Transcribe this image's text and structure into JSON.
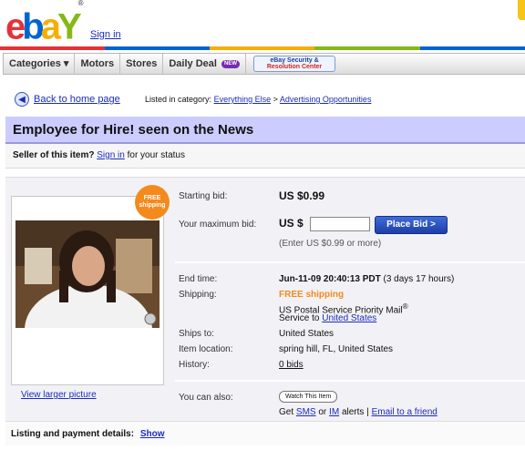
{
  "header": {
    "logo": {
      "e": "e",
      "b": "b",
      "a": "a",
      "y": "Y",
      "reg": "®"
    },
    "signin": "Sign in",
    "rainbow_colors": [
      "#e53238",
      "#0064d2",
      "#f5af02",
      "#86b817",
      "#0064d2"
    ]
  },
  "nav": {
    "categories": "Categories ▾",
    "motors": "Motors",
    "stores": "Stores",
    "daily_deal": "Daily Deal",
    "new_badge": "NEW",
    "security_l1": "eBay Security &",
    "security_l2": "Resolution Center"
  },
  "breadcrumb": {
    "back": "Back to home page",
    "listed_in": "Listed in category:",
    "cat1": "Everything Else",
    "gt": ">",
    "cat2": "Advertising Opportunities"
  },
  "item": {
    "title": "Employee for Hire! seen on the News",
    "seller_label": "Seller of this item?",
    "seller_signin": "Sign in",
    "seller_suffix": "for your status",
    "free_badge_l1": "FREE",
    "free_badge_l2": "shipping",
    "view_larger": "View larger picture"
  },
  "bid": {
    "starting_label": "Starting bid:",
    "starting_value": "US $0.99",
    "max_label": "Your maximum bid:",
    "usd": "US $",
    "input_value": "",
    "place_bid": "Place Bid >",
    "hint": "(Enter US $0.99 or more)"
  },
  "details": {
    "end_label": "End time:",
    "end_value": "Jun-11-09 20:40:13 PDT",
    "end_remaining": "(3 days 17 hours)",
    "ship_label": "Shipping:",
    "ship_free": "FREE shipping",
    "ship_service": "US Postal Service Priority Mail",
    "ship_reg": "®",
    "ship_to_prefix": "Service to",
    "ship_to_link": "United States",
    "ships_to_label": "Ships to:",
    "ships_to_value": "United States",
    "location_label": "Item location:",
    "location_value": "spring hill, FL, United States",
    "history_label": "History:",
    "history_value": "0 bids"
  },
  "also": {
    "label": "You can also:",
    "watch": "Watch This Item",
    "get": "Get",
    "sms": "SMS",
    "or": "or",
    "im": "IM",
    "alerts": "alerts |",
    "email": "Email to a friend"
  },
  "listing": {
    "label": "Listing and payment details:",
    "show": "Show"
  }
}
